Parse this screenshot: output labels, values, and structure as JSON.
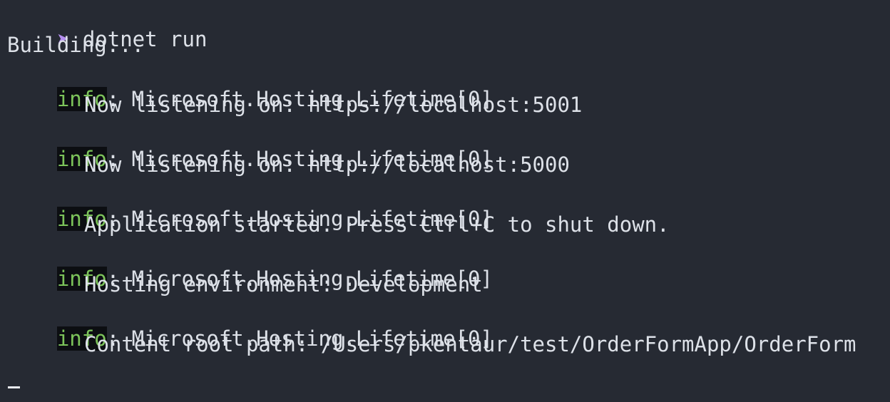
{
  "terminal": {
    "prompt_symbol": "➤",
    "command": "dotnet run",
    "building": "Building...",
    "logs": [
      {
        "level": "info",
        "category": ": Microsoft.Hosting.Lifetime[0]",
        "message": "Now listening on: https://localhost:5001"
      },
      {
        "level": "info",
        "category": ": Microsoft.Hosting.Lifetime[0]",
        "message": "Now listening on: http://localhost:5000"
      },
      {
        "level": "info",
        "category": ": Microsoft.Hosting.Lifetime[0]",
        "message": "Application started. Press Ctrl+C to shut down."
      },
      {
        "level": "info",
        "category": ": Microsoft.Hosting.Lifetime[0]",
        "message": "Hosting environment: Development"
      },
      {
        "level": "info",
        "category": ": Microsoft.Hosting.Lifetime[0]",
        "message": "Content root path: /Users/pkentaur/test/OrderFormApp/OrderForm"
      }
    ],
    "colors": {
      "background": "#262a33",
      "text": "#dde1e8",
      "prompt": "#b48ef0",
      "info_level": "#7cc35a"
    }
  }
}
